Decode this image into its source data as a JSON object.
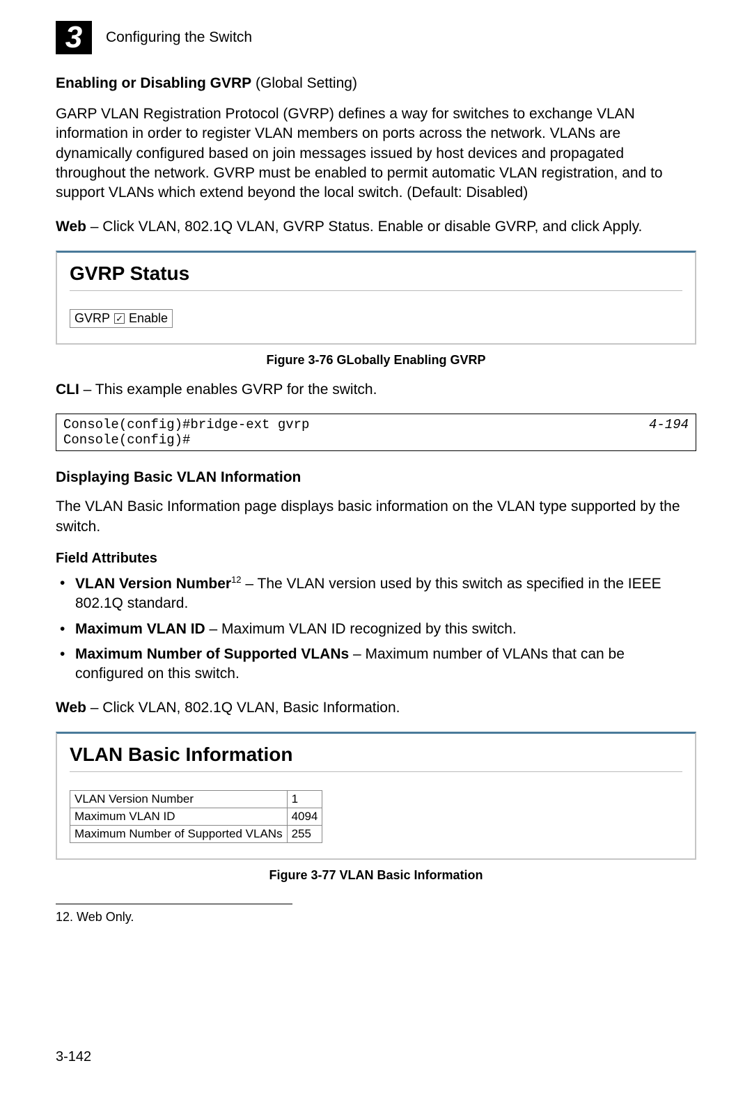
{
  "header": {
    "chapter_number": "3",
    "chapter_title": "Configuring the Switch"
  },
  "section1": {
    "heading_bold": "Enabling or Disabling GVRP",
    "heading_rest": " (Global Setting)",
    "para1": "GARP VLAN Registration Protocol (GVRP) defines a way for switches to exchange VLAN information in order to register VLAN members on ports across the network. VLANs are dynamically configured based on join messages issued by host devices and propagated throughout the network. GVRP must be enabled to permit automatic VLAN registration, and to support VLANs which extend beyond the local switch. (Default: Disabled)",
    "web_label": "Web",
    "web_text": " – Click VLAN, 802.1Q VLAN, GVRP Status. Enable or disable GVRP, and click Apply."
  },
  "gvrp_panel": {
    "title": "GVRP Status",
    "row_label": "GVRP",
    "checkbox_checked": "✓",
    "enable_label": "Enable"
  },
  "figure76": "Figure 3-76  GLobally Enabling GVRP",
  "cli": {
    "label": "CLI",
    "text": " – This example enables GVRP for the switch.",
    "left": "Console(config)#bridge-ext gvrp\nConsole(config)#",
    "right": "4-194"
  },
  "section2": {
    "heading": "Displaying Basic VLAN Information",
    "para": "The VLAN Basic Information page displays basic information on the VLAN type supported by the switch.",
    "field_attrs_title": "Field Attributes",
    "bullets": [
      {
        "bold": "VLAN Version Number",
        "sup": "12",
        "rest": " – The VLAN version used by this switch as specified in the IEEE 802.1Q standard."
      },
      {
        "bold": "Maximum VLAN ID",
        "sup": "",
        "rest": " – Maximum VLAN ID recognized by this switch."
      },
      {
        "bold": "Maximum Number of Supported VLANs",
        "sup": "",
        "rest": " – Maximum number of VLANs that can be configured on this switch."
      }
    ],
    "web_label": "Web",
    "web_text": " – Click VLAN, 802.1Q VLAN, Basic Information."
  },
  "vlan_panel": {
    "title": "VLAN Basic Information",
    "rows": [
      {
        "label": "VLAN Version Number",
        "value": "1"
      },
      {
        "label": "Maximum VLAN ID",
        "value": "4094"
      },
      {
        "label": "Maximum Number of Supported VLANs",
        "value": "255"
      }
    ]
  },
  "figure77": "Figure 3-77  VLAN Basic Information",
  "footnote": "12. Web Only.",
  "page_number": "3-142"
}
